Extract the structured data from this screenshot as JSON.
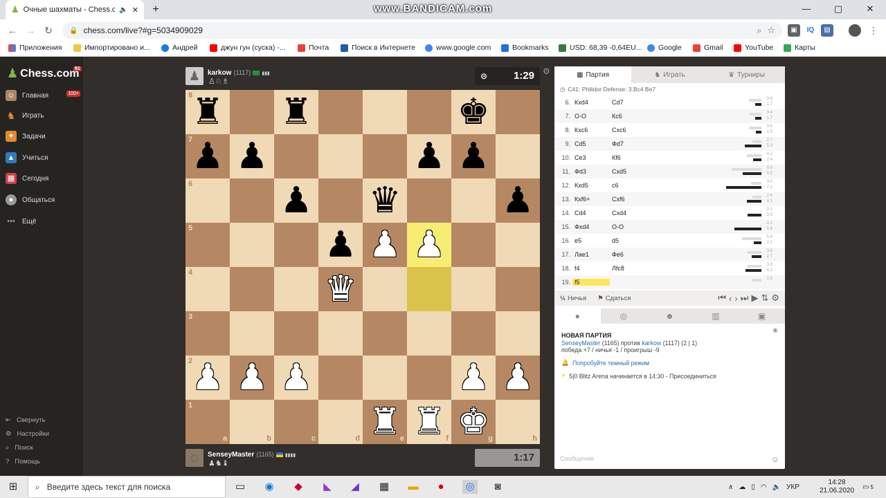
{
  "browser": {
    "tab_title": "Очные шахматы - Chess.com",
    "url": "chess.com/live?#g=5034909029",
    "watermark": "www.BANDICAM.com"
  },
  "bookmarks": [
    "Приложения",
    "Импортировано и...",
    "Андрей",
    "джун гун (суска) -...",
    "Почта",
    "Поиск в Интернете",
    "www.google.com",
    "Bookmarks",
    "USD: 68,39 -0,64EU...",
    "Google",
    "Gmail",
    "YouTube",
    "Карты"
  ],
  "sidebar": {
    "logo": "Chess.com",
    "logo_badge": "91",
    "items": [
      {
        "label": "Главная",
        "badge": "100+"
      },
      {
        "label": "Играть"
      },
      {
        "label": "Задачи"
      },
      {
        "label": "Учиться"
      },
      {
        "label": "Сегодня"
      },
      {
        "label": "Общаться"
      },
      {
        "label": "Ещё"
      }
    ],
    "bottom": [
      "Свернуть",
      "Настройки",
      "Поиск",
      "Помощь"
    ]
  },
  "top_player": {
    "name": "karkow",
    "rating": "(1117)",
    "clock": "1:29"
  },
  "bottom_player": {
    "name": "SenseyMaster",
    "rating": "(1165)",
    "clock": "1:17"
  },
  "board": {
    "rows": [
      [
        "r",
        "",
        "r",
        "",
        "",
        "",
        "k",
        ""
      ],
      [
        "p",
        "p",
        "",
        "",
        "",
        "p",
        "p",
        ""
      ],
      [
        "",
        "",
        "p",
        "",
        "q",
        "",
        "",
        "p"
      ],
      [
        "",
        "",
        "",
        "p",
        "P",
        "P",
        "",
        ""
      ],
      [
        "",
        "",
        "",
        "Q",
        "",
        "",
        "",
        ""
      ],
      [
        "",
        "",
        "",
        "",
        "",
        "",
        "",
        ""
      ],
      [
        "P",
        "P",
        "P",
        "",
        "",
        "",
        "P",
        "P"
      ],
      [
        "",
        "",
        "",
        "",
        "R",
        "R",
        "K",
        ""
      ]
    ],
    "files": [
      "a",
      "b",
      "c",
      "d",
      "e",
      "f",
      "g",
      "h"
    ],
    "ranks": [
      "8",
      "7",
      "6",
      "5",
      "4",
      "3",
      "2",
      "1"
    ]
  },
  "panel": {
    "tabs": [
      "Партия",
      "Играть",
      "Турниры"
    ],
    "opening": "C41: Philidor Defense: 3.Bc4 Be7",
    "moves": [
      {
        "n": "6.",
        "w": "Кxd4",
        "b": "Сd7",
        "tw": "3.6",
        "tb": "1.7",
        "ww": 0.3,
        "wb": 0.15
      },
      {
        "n": "7.",
        "w": "O-O",
        "b": "Кc6",
        "tw": "3.4",
        "tb": "1.7",
        "ww": 0.28,
        "wb": 0.15
      },
      {
        "n": "8.",
        "w": "Кxc6",
        "b": "Сxc6",
        "tw": "3.6",
        "tb": "1.5",
        "ww": 0.3,
        "wb": 0.13
      },
      {
        "n": "9.",
        "w": "Сd5",
        "b": "Фd7",
        "tw": "2.7",
        "tb": "5.0",
        "ww": 0.22,
        "wb": 0.4
      },
      {
        "n": "10.",
        "w": "Сe3",
        "b": "Кf6",
        "tw": "4.2",
        "tb": "2.4",
        "ww": 0.35,
        "wb": 0.2
      },
      {
        "n": "11.",
        "w": "Фd3",
        "b": "Сxd5",
        "tw": "8.6",
        "tb": "5.5",
        "ww": 0.72,
        "wb": 0.45
      },
      {
        "n": "12.",
        "w": "Кxd5",
        "b": "c6",
        "tw": "3.0",
        "tb": "7.1",
        "ww": 0.25,
        "wb": 0.85
      },
      {
        "n": "13.",
        "w": "Кxf6+",
        "b": "Сxf6",
        "tw": "2.6",
        "tb": "4.1",
        "ww": 0.22,
        "wb": 0.35
      },
      {
        "n": "14.",
        "w": "Сd4",
        "b": "Сxd4",
        "tw": "0.1",
        "tb": "3.9",
        "ww": 0.02,
        "wb": 0.33
      },
      {
        "n": "15.",
        "w": "Фxd4",
        "b": "O-O",
        "tw": "0.1",
        "tb": "5.8",
        "ww": 0.02,
        "wb": 0.65
      },
      {
        "n": "16.",
        "w": "e5",
        "b": "d5",
        "tw": "5.6",
        "tb": "2.1",
        "ww": 0.47,
        "wb": 0.18
      },
      {
        "n": "17.",
        "w": "Лae1",
        "b": "Фe6",
        "tw": "3.9",
        "tb": "2.7",
        "ww": 0.33,
        "wb": 0.23
      },
      {
        "n": "18.",
        "w": "f4",
        "b": "Лfc8",
        "tw": "3.9",
        "tb": "4.2",
        "ww": 0.33,
        "wb": 0.38
      },
      {
        "n": "19.",
        "w": "f5",
        "b": "",
        "tw": "2.6",
        "tb": "",
        "ww": 0.22,
        "wb": 0
      }
    ],
    "draw_label": "Ничья",
    "resign_label": "Сдаться",
    "draw_icon_text": "½"
  },
  "chat": {
    "header": "НОВАЯ ПАРТИЯ",
    "line_player1": "SenseyMaster",
    "line_rating1": "(1165)",
    "line_vs": "против",
    "line_player2": "karkow",
    "line_rating2": "(1117)",
    "line_score": "(2 | 1)",
    "stats": "победа +7 / ничья -1 / проигрыш -9",
    "tip": "Попробуйте темный режим",
    "arena": "5|0 Blitz Arena начинается в 14:30 - Присоединиться",
    "input_placeholder": "Сообщение"
  },
  "taskbar": {
    "search_placeholder": "Введите здесь текст для поиска",
    "lang": "УКР",
    "time": "14:28",
    "date": "21.06.2020",
    "notif": "5"
  }
}
